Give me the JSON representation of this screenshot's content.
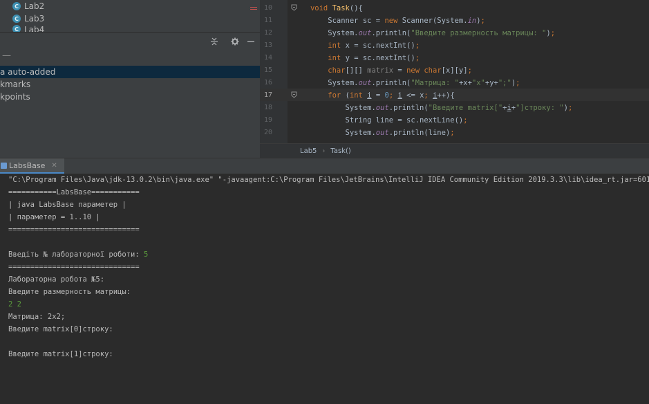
{
  "project_tree": {
    "items": [
      {
        "label": "Lab2",
        "icon": "class-icon"
      },
      {
        "label": "Lab3",
        "icon": "class-icon"
      },
      {
        "label": "Lab4",
        "icon": "class-icon"
      }
    ]
  },
  "toolbar": {
    "collapse_icon": "collapse-icon",
    "settings_icon": "gear-icon",
    "hide_icon": "minimize-icon"
  },
  "bookmarks": {
    "minus_label": "—",
    "items": [
      {
        "label": "a auto-added",
        "selected": true
      },
      {
        "label": "kmarks",
        "selected": false
      },
      {
        "label": "kpoints",
        "selected": false
      }
    ]
  },
  "editor": {
    "line_numbers": [
      "10",
      "11",
      "12",
      "13",
      "14",
      "15",
      "16",
      "17",
      "18",
      "19",
      "20"
    ],
    "current_line": "17",
    "breadcrumb": {
      "class_name": "Lab5",
      "method_name": "Task()",
      "separator": "›"
    }
  },
  "run_window": {
    "tab_label": "LabsBase",
    "tab_close": "✕",
    "console_lines": [
      {
        "text": "\"C:\\Program Files\\Java\\jdk-13.0.2\\bin\\java.exe\" \"-javaagent:C:\\Program Files\\JetBrains\\IntelliJ IDEA Community Edition 2019.3.3\\lib\\idea_rt.jar=601",
        "type": "out"
      },
      {
        "text": "===========LabsBase===========",
        "type": "out"
      },
      {
        "text": "| java LabsBase параметер |",
        "type": "out"
      },
      {
        "text": "| параметер = 1..10 |",
        "type": "out"
      },
      {
        "text": "==============================",
        "type": "out"
      },
      {
        "text": "",
        "type": "out"
      },
      {
        "text": "Введіть № лабораторної роботи: ",
        "type": "out",
        "input_suffix": "5"
      },
      {
        "text": "==============================",
        "type": "out"
      },
      {
        "text": "Лабораторна робота №5:",
        "type": "out"
      },
      {
        "text": "Введите размерность матрицы:",
        "type": "out"
      },
      {
        "text": "2 2",
        "type": "input"
      },
      {
        "text": "Матрица: 2x2;",
        "type": "out"
      },
      {
        "text": "Введите matrix[0]строку:",
        "type": "out"
      },
      {
        "text": "",
        "type": "out"
      },
      {
        "text": "Введите matrix[1]строку:",
        "type": "out"
      }
    ]
  },
  "colors": {
    "editor_bg": "#2b2b2b",
    "panel_bg": "#3c3f41",
    "keyword": "#cc7832",
    "string": "#6a8759",
    "method": "#ffc66d",
    "field": "#9876aa",
    "console_input": "#5c9e3c",
    "selection": "#0d293e"
  }
}
